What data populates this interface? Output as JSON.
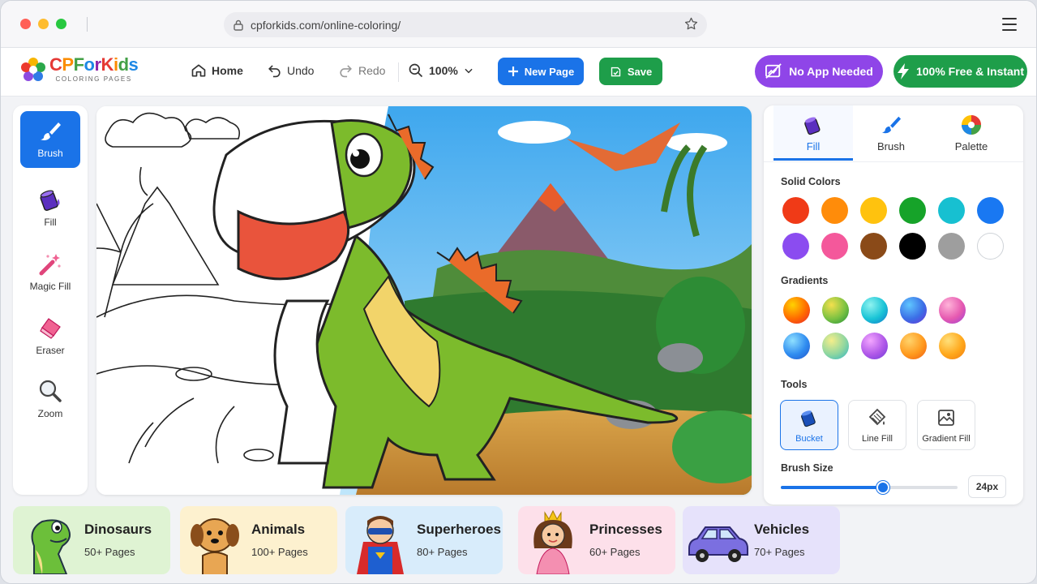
{
  "browser": {
    "url": "cpforkids.com/online-coloring/"
  },
  "logo": {
    "name": "CPForKids",
    "sub": "COLORING PAGES"
  },
  "nav": {
    "home": "Home",
    "undo": "Undo",
    "redo": "Redo",
    "zoom": "100%",
    "new_page": "New Page",
    "save": "Save"
  },
  "badges": {
    "no_app": "No App Needed",
    "free": "100% Free & Instant"
  },
  "tools": [
    {
      "label": "Brush",
      "icon": "brush-icon"
    },
    {
      "label": "Fill",
      "icon": "paint-bucket-icon"
    },
    {
      "label": "Magic Fill",
      "icon": "magic-wand-icon"
    },
    {
      "label": "Eraser",
      "icon": "eraser-icon"
    },
    {
      "label": "Zoom",
      "icon": "magnifier-icon"
    }
  ],
  "panel": {
    "tabs": [
      "Fill",
      "Brush",
      "Palette"
    ],
    "solid_title": "Solid Colors",
    "solid_colors": [
      "#f03a17",
      "#ff8c0a",
      "#ffc20e",
      "#16a329",
      "#17c0d1",
      "#1978f2",
      "#8b4cf0",
      "#f4589b",
      "#8a4a18",
      "#000000",
      "#9e9e9e",
      "#ffffff"
    ],
    "gradients_title": "Gradients",
    "tools_title": "Tools",
    "tool_options": [
      "Bucket",
      "Line Fill",
      "Gradient Fill"
    ],
    "brush_size_title": "Brush Size",
    "brush_size": "24px",
    "brush_size_level": 0.58
  },
  "categories": [
    {
      "name": "Dinosaurs",
      "count": "50+ Pages",
      "bg": "#dff3d3"
    },
    {
      "name": "Animals",
      "count": "100+ Pages",
      "bg": "#fdf1cf"
    },
    {
      "name": "Superheroes",
      "count": "80+ Pages",
      "bg": "#d8ecfb"
    },
    {
      "name": "Princesses",
      "count": "60+ Pages",
      "bg": "#fde0ea"
    },
    {
      "name": "Vehicles",
      "count": "70+ Pages",
      "bg": "#e6e2fb"
    }
  ]
}
